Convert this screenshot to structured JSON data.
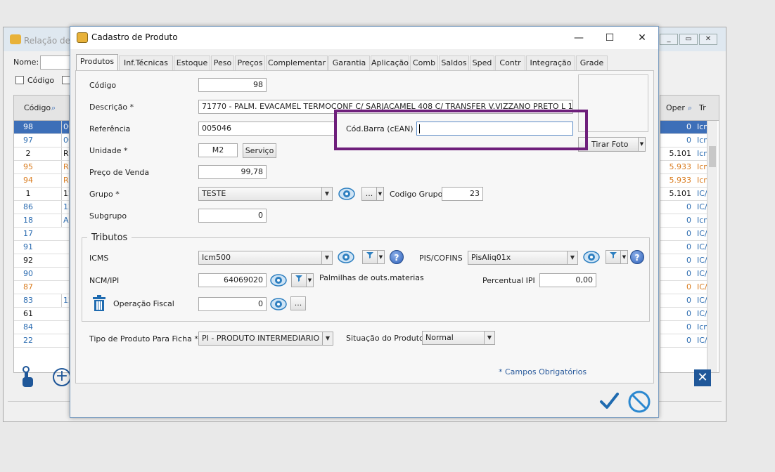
{
  "background_window": {
    "title": "Relação de P",
    "nome_label": "Nome:",
    "codigo_check_label": "Código",
    "col_codigo": "Código",
    "col_oper": "Oper",
    "col_tr": "Tr",
    "codes": [
      "98",
      "97",
      "2",
      "95",
      "94",
      "1",
      "86",
      "18",
      "17",
      "91",
      "92",
      "90",
      "87",
      "83",
      "61",
      "84",
      "22"
    ],
    "refs": [
      "005",
      "001",
      "REF",
      "REF",
      "REF",
      "123",
      "123",
      "AMA",
      "",
      "",
      "",
      "",
      "",
      "123",
      "",
      "",
      ""
    ],
    "opers": [
      "0",
      "0",
      "5.101",
      "5.933",
      "5.933",
      "5.101",
      "0",
      "0",
      "0",
      "0",
      "0",
      "0",
      "0",
      "0",
      "0",
      "0",
      "0"
    ],
    "trs": [
      "Icm",
      "Icm",
      "Icm",
      "Icm",
      "Icm",
      "IC/",
      "IC/",
      "Icm",
      "IC/",
      "IC/",
      "IC/",
      "IC/",
      "IC/",
      "IC/",
      "IC/",
      "Icm",
      "IC/"
    ]
  },
  "dialog": {
    "title": "Cadastro de Produto",
    "tabs": [
      "Produtos",
      "Inf.Técnicas",
      "Estoque",
      "Peso",
      "Preços",
      "Complementar",
      "Garantia",
      "Aplicação",
      "Comb",
      "Saldos",
      "Sped",
      "Contr",
      "Integração",
      "Grade"
    ],
    "codigo_label": "Código",
    "codigo_value": "98",
    "descricao_label": "Descrição *",
    "descricao_value": "71770 - PALM. EVACAMEL TERMOCONF C/ SARJACAMEL 408 C/ TRANSFER V.VIZZANO PRETO L  1214",
    "referencia_label": "Referência",
    "referencia_value": "005046",
    "codbarra_label": "Cód.Barra  (cEAN)",
    "codbarra_value": "",
    "unidade_label": "Unidade *",
    "unidade_value": "M2",
    "servico_button": "Serviço",
    "preco_label": "Preço de Venda",
    "preco_value": "99,78",
    "grupo_label": "Grupo *",
    "grupo_value": "TESTE",
    "grupo_more": "...",
    "codigo_grupo_label": "Codigo Grupo",
    "codigo_grupo_value": "23",
    "subgrupo_label": "Subgrupo",
    "subgrupo_value": "0",
    "tirar_foto": "Tirar Foto",
    "tributos_legend": "Tributos",
    "icms_label": "ICMS",
    "icms_value": "Icm500",
    "piscofins_label": "PIS/COFINS",
    "piscofins_value": "PisAliq01x",
    "ncm_label": "NCM/IPI",
    "ncm_value": "64069020",
    "ncm_desc": "Palmilhas de outs.materias",
    "percentual_ipi_label": "Percentual IPI",
    "percentual_ipi_value": "0,00",
    "operacao_fiscal_label": "Operação Fiscal",
    "operacao_fiscal_value": "0",
    "operacao_more": "...",
    "tipo_produto_label": "Tipo de Produto Para Ficha *",
    "tipo_produto_value": "PI - PRODUTO INTERMEDIARIO",
    "situacao_label": "Situação do Produto",
    "situacao_value": "Normal",
    "required_note": "* Campos Obrigatórios"
  },
  "colors": {
    "highlight": "#6e1f7b",
    "selected_row": "#3d6fb8",
    "orange_text": "#d97b1d",
    "link_blue": "#2a5b9c"
  }
}
